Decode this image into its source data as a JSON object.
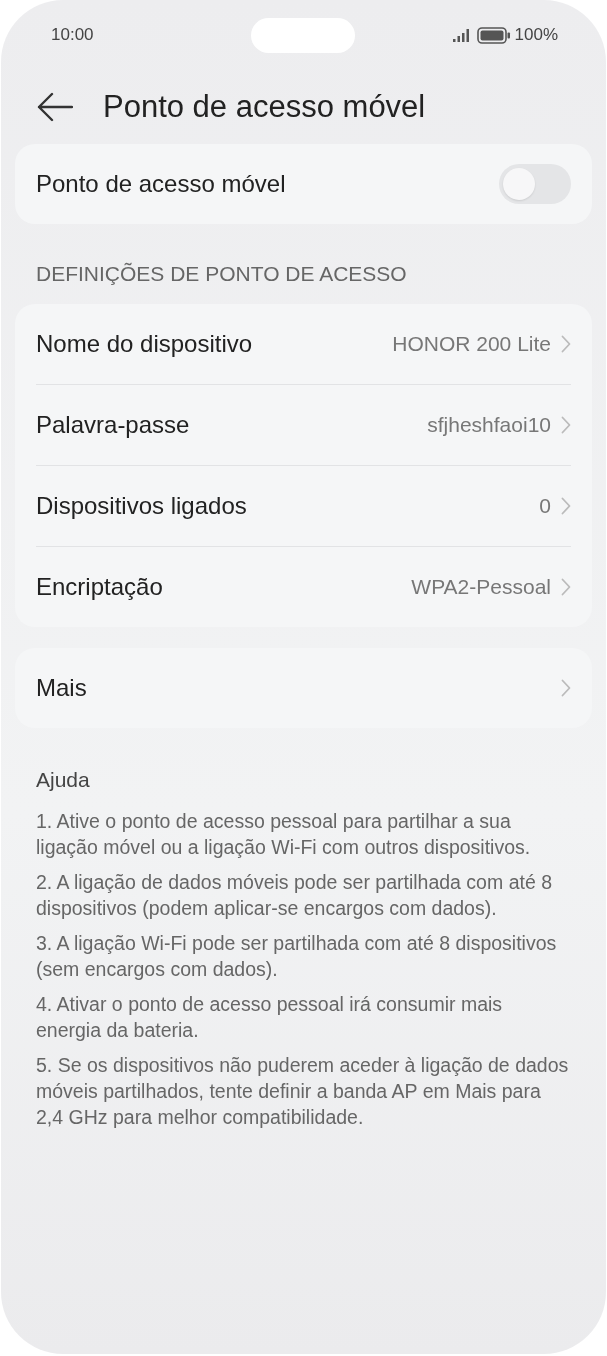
{
  "status_bar": {
    "time": "10:00",
    "battery": "100%"
  },
  "header": {
    "title": "Ponto de acesso móvel"
  },
  "hotspot": {
    "label": "Ponto de acesso móvel",
    "on": false
  },
  "settings_section": {
    "title": "DEFINIÇÕES DE PONTO DE ACESSO",
    "rows": [
      {
        "label": "Nome do dispositivo",
        "value": "HONOR 200 Lite"
      },
      {
        "label": "Palavra-passe",
        "value": "sfjheshfaoi10"
      },
      {
        "label": "Dispositivos ligados",
        "value": "0"
      },
      {
        "label": "Encriptação",
        "value": "WPA2-Pessoal"
      }
    ]
  },
  "more": {
    "label": "Mais"
  },
  "help": {
    "title": "Ajuda",
    "paragraphs": [
      "1. Ative o ponto de acesso pessoal para partilhar a sua ligação móvel ou a ligação Wi-Fi com outros dispositivos.",
      "2. A ligação de dados móveis pode ser partilhada com até 8 dispositivos (podem aplicar-se encargos com dados).",
      "3. A ligação Wi-Fi pode ser partilhada com até 8 dispositivos (sem encargos com dados).",
      "4. Ativar o ponto de acesso pessoal irá consumir mais energia da bateria.",
      "5. Se os dispositivos não puderem aceder à ligação de dados móveis partilhados, tente definir a banda AP em Mais para 2,4 GHz para melhor compatibilidade."
    ]
  }
}
